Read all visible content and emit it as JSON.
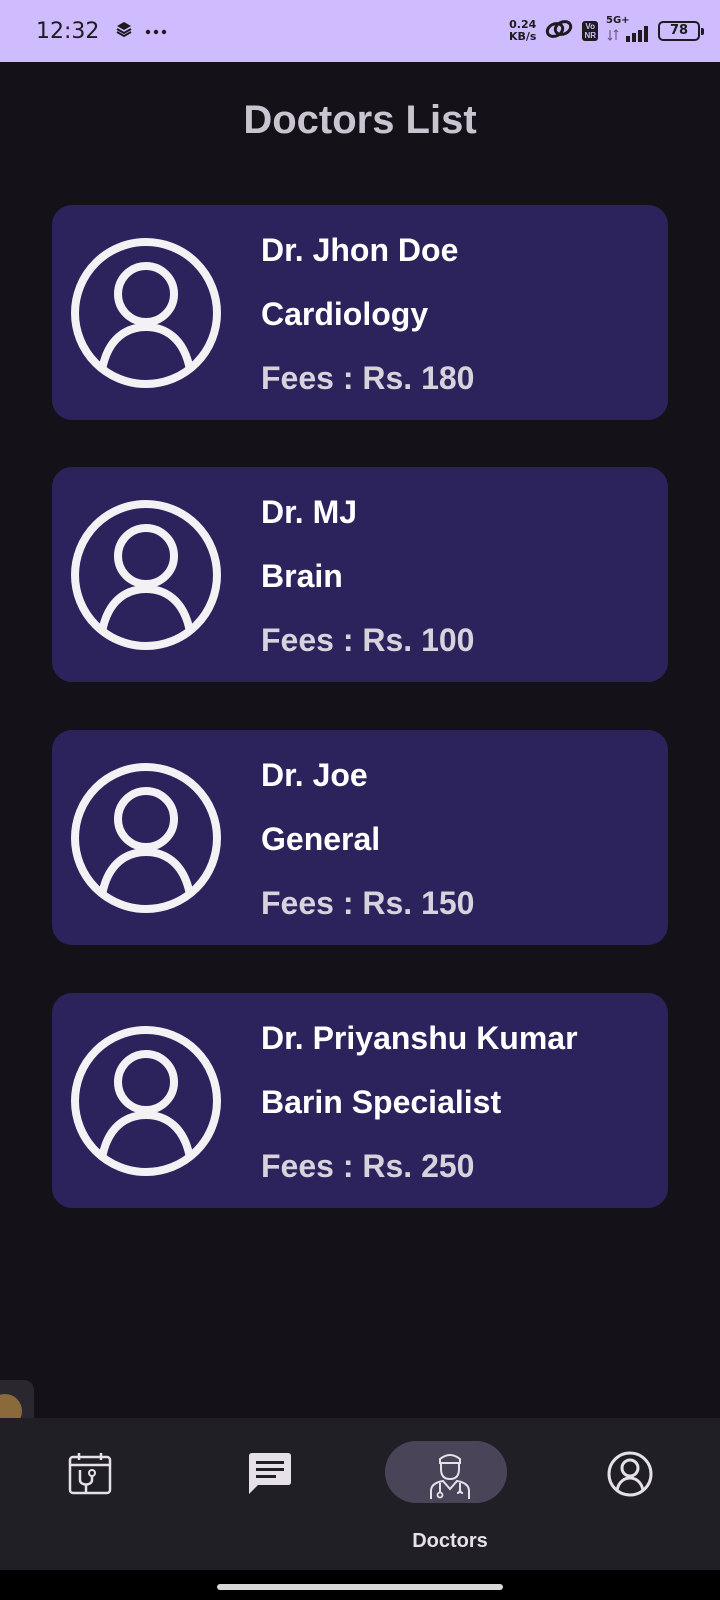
{
  "status_bar": {
    "time": "12:32",
    "net_speed_value": "0.24",
    "net_speed_unit": "KB/s",
    "volte_top": "Vo",
    "volte_bottom": "NR",
    "network": "5G+",
    "battery": "78"
  },
  "page": {
    "title": "Doctors List"
  },
  "doctors": [
    {
      "name": "Dr. Jhon Doe",
      "specialty": "Cardiology",
      "fees": "Fees : Rs. 180"
    },
    {
      "name": "Dr. MJ",
      "specialty": "Brain",
      "fees": "Fees : Rs. 100"
    },
    {
      "name": "Dr. Joe",
      "specialty": "General",
      "fees": "Fees : Rs. 150"
    },
    {
      "name": "Dr. Priyanshu Kumar",
      "specialty": "Barin Specialist",
      "fees": "Fees : Rs. 250"
    }
  ],
  "bottom_nav": {
    "items": [
      {
        "icon": "calendar-stethoscope-icon",
        "label": ""
      },
      {
        "icon": "chat-icon",
        "label": ""
      },
      {
        "icon": "doctor-icon",
        "label": "Doctors",
        "selected": true
      },
      {
        "icon": "account-circle-icon",
        "label": ""
      }
    ]
  },
  "colors": {
    "background": "#141218",
    "status_bar": "#cfbcff",
    "card": "#2d235c",
    "nav_bar": "#211f26",
    "nav_pill": "#4a4458"
  }
}
